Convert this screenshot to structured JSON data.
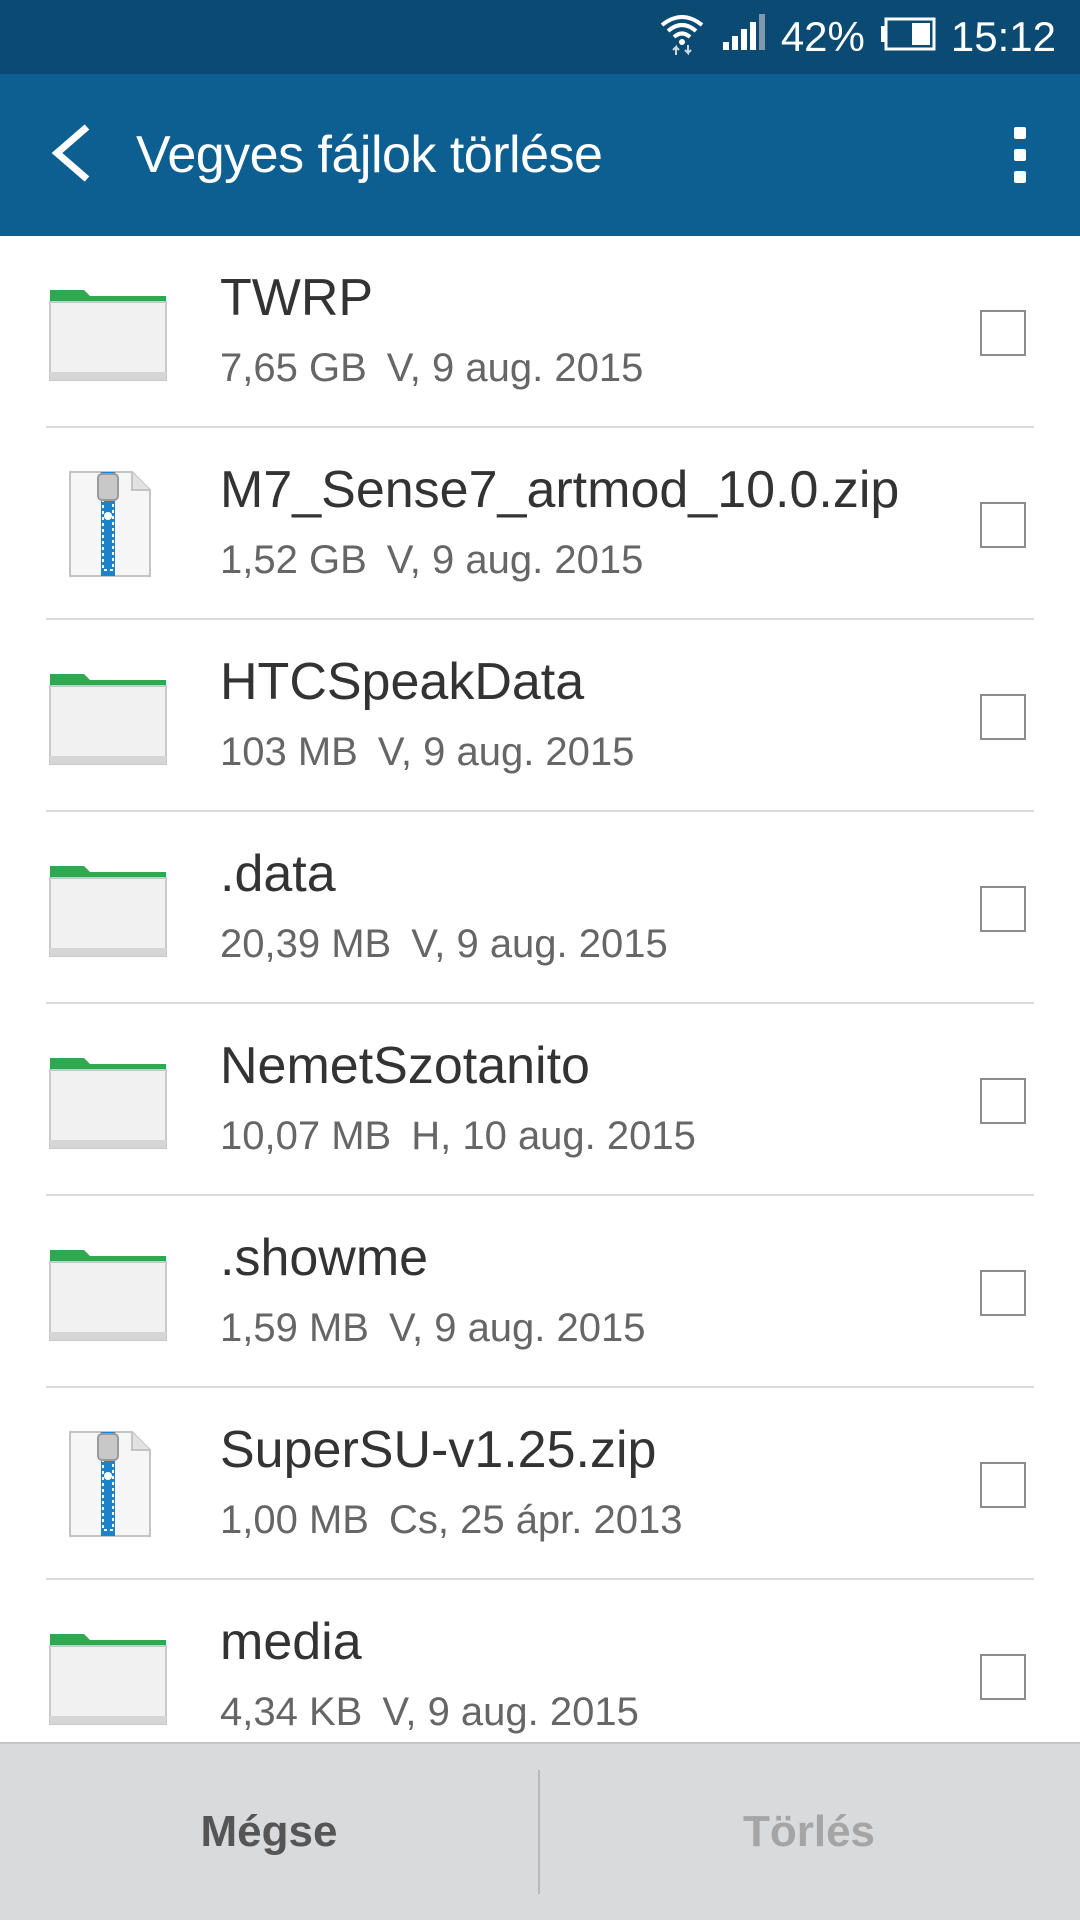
{
  "status_bar": {
    "wifi_icon": "wifi-icon",
    "signal_icon": "signal-icon",
    "battery_percent": "42%",
    "battery_icon": "battery-icon",
    "time": "15:12"
  },
  "app_bar": {
    "back_icon": "back-arrow-icon",
    "title": "Vegyes fájlok törlése",
    "menu_icon": "more-vert-icon"
  },
  "files": [
    {
      "name": "TWRP",
      "size": "7,65 GB",
      "date": "V, 9 aug. 2015",
      "icon": "folder-icon"
    },
    {
      "name": "M7_Sense7_artmod_10.0.zip",
      "size": "1,52 GB",
      "date": "V, 9 aug. 2015",
      "icon": "zip-file-icon"
    },
    {
      "name": "HTCSpeakData",
      "size": "103 MB",
      "date": "V, 9 aug. 2015",
      "icon": "folder-icon"
    },
    {
      "name": ".data",
      "size": "20,39 MB",
      "date": "V, 9 aug. 2015",
      "icon": "folder-icon"
    },
    {
      "name": "NemetSzotanito",
      "size": "10,07 MB",
      "date": "H, 10 aug. 2015",
      "icon": "folder-icon"
    },
    {
      "name": ".showme",
      "size": "1,59 MB",
      "date": "V, 9 aug. 2015",
      "icon": "folder-icon"
    },
    {
      "name": "SuperSU-v1.25.zip",
      "size": "1,00 MB",
      "date": "Cs, 25 ápr. 2013",
      "icon": "zip-file-icon"
    },
    {
      "name": "media",
      "size": "4,34 KB",
      "date": "V, 9 aug. 2015",
      "icon": "folder-icon"
    }
  ],
  "bottom_bar": {
    "cancel_label": "Mégse",
    "delete_label": "Törlés"
  },
  "colors": {
    "status_bar": "#0b4a73",
    "app_bar": "#0e5f91",
    "folder_tab": "#2fa84f",
    "zip_zipper": "#1d82c8"
  }
}
